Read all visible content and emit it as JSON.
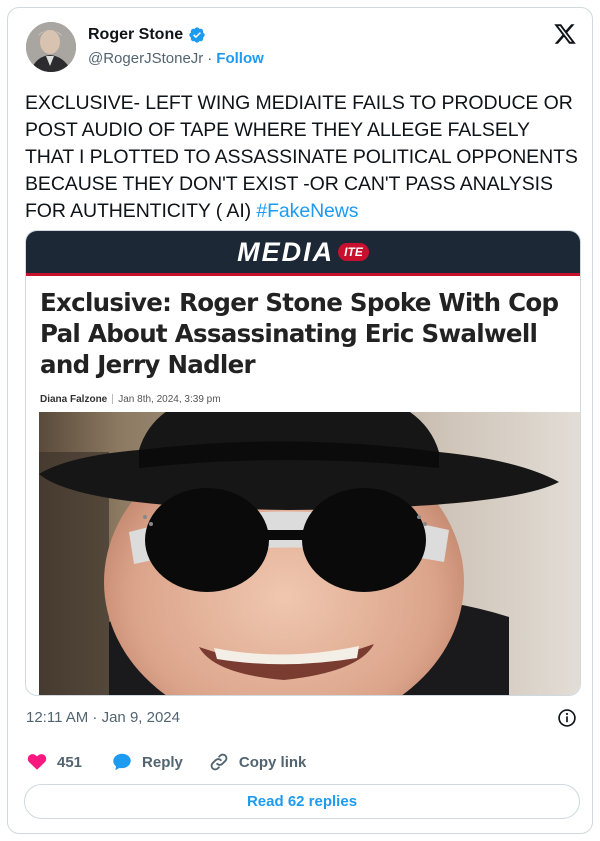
{
  "author": {
    "name": "Roger Stone",
    "handle": "@RogerJStoneJr",
    "separator": "·",
    "follow_label": "Follow",
    "verified_icon": "verified-badge-icon"
  },
  "tweet": {
    "text": "EXCLUSIVE- LEFT WING MEDIAITE FAILS TO PRODUCE OR POST AUDIO OF TAPE WHERE THEY ALLEGE FALSELY THAT I  PLOTTED TO ASSASSINATE POLITICAL OPPONENTS BECAUSE THEY DON'T EXIST -OR CAN'T PASS ANALYSIS FOR AUTHENTICITY ( AI)",
    "hashtag": "#FakeNews"
  },
  "media": {
    "brand": "MEDIA",
    "brand_suffix": "ITE",
    "headline": "Exclusive: Roger Stone Spoke With Cop Pal About Assassinating Eric Swalwell and Jerry Nadler",
    "byline_author": "Diana Falzone",
    "byline_date": "Jan 8th, 2024, 3:39 pm"
  },
  "meta": {
    "timestamp": "12:11 AM · Jan 9, 2024"
  },
  "actions": {
    "like_count": "451",
    "reply_label": "Reply",
    "copy_label": "Copy link",
    "read_replies_label": "Read 62 replies"
  },
  "colors": {
    "accent": "#1d9bf0",
    "like": "#f91880",
    "text": "#0f1419",
    "secondary": "#536471",
    "mediaite_navy": "#1c2836",
    "mediaite_red": "#c8102e"
  }
}
